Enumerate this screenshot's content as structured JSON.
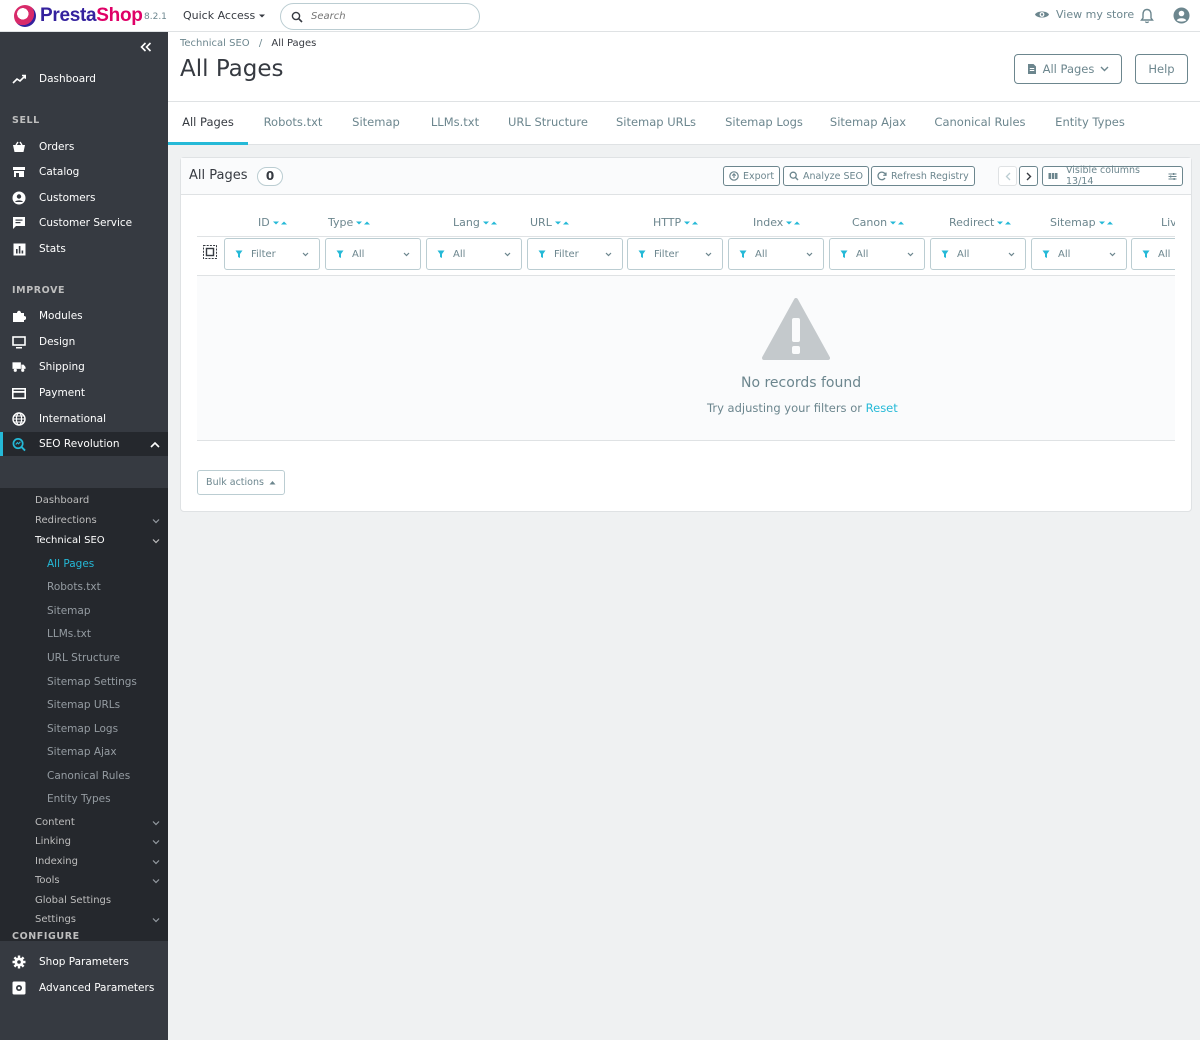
{
  "header": {
    "logo_text_a": "Presta",
    "logo_text_b": "Shop",
    "version": "8.2.1",
    "quick_access": "Quick Access",
    "search_placeholder": "Search",
    "view_store": "View my store"
  },
  "sidebar": {
    "dashboard": "Dashboard",
    "sections": {
      "sell": "SELL",
      "improve": "IMPROVE",
      "configure": "CONFIGURE"
    },
    "sell": [
      "Orders",
      "Catalog",
      "Customers",
      "Customer Service",
      "Stats"
    ],
    "improve": [
      "Modules",
      "Design",
      "Shipping",
      "Payment",
      "International"
    ],
    "seo": "SEO Revolution",
    "seo_sub": [
      "Dashboard",
      "Redirections",
      "Technical SEO"
    ],
    "technical": [
      "All Pages",
      "Robots.txt",
      "Sitemap",
      "LLMs.txt",
      "URL Structure",
      "Sitemap Settings",
      "Sitemap URLs",
      "Sitemap Logs",
      "Sitemap Ajax",
      "Canonical Rules",
      "Entity Types"
    ],
    "seo_sub2": [
      "Content",
      "Linking",
      "Indexing",
      "Tools",
      "Global Settings",
      "Settings"
    ],
    "configure": [
      "Shop Parameters",
      "Advanced Parameters"
    ]
  },
  "page": {
    "breadcrumb_parent": "Technical SEO",
    "breadcrumb_sep": "/",
    "breadcrumb_current": "All Pages",
    "title": "All Pages",
    "all_pages_button": "All Pages",
    "help_button": "Help"
  },
  "tabs": [
    "All Pages",
    "Robots.txt",
    "Sitemap",
    "LLMs.txt",
    "URL Structure",
    "Sitemap URLs",
    "Sitemap Logs",
    "Sitemap Ajax",
    "Canonical Rules",
    "Entity Types"
  ],
  "panel": {
    "title": "All Pages",
    "count": "0",
    "export": "Export",
    "analyze": "Analyze SEO",
    "refresh": "Refresh Registry",
    "visible_columns": "Visible columns 13/14",
    "columns": [
      "ID",
      "Type",
      "Lang",
      "URL",
      "HTTP",
      "Index",
      "Canon",
      "Redirect",
      "Sitemap",
      "Live"
    ],
    "filters": [
      "Filter",
      "All",
      "All",
      "Filter",
      "Filter",
      "All",
      "All",
      "All",
      "All",
      "All"
    ],
    "empty_title": "No records found",
    "empty_text": "Try adjusting your filters or",
    "reset": "Reset",
    "bulk_actions": "Bulk actions"
  },
  "colors": {
    "accent": "#25b9d7",
    "sidebar": "#363a41",
    "sidebar_sub": "#25282d",
    "brand_pink": "#df0067",
    "brand_purple": "#34219e"
  }
}
